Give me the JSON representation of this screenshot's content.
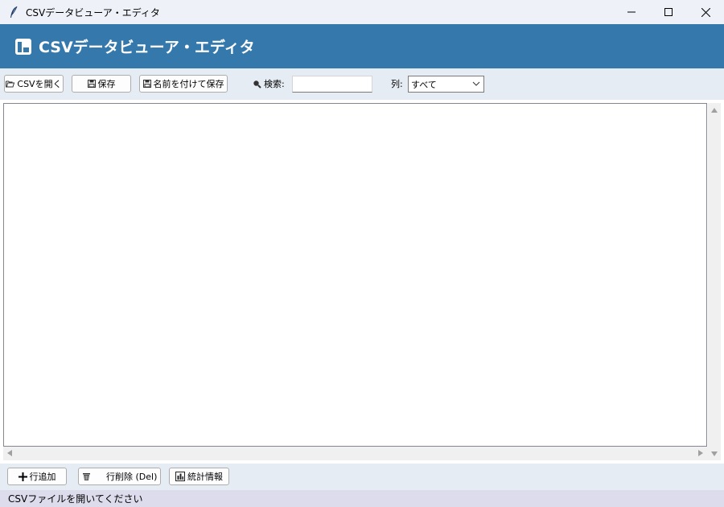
{
  "window": {
    "title": "CSVデータビューア・エディタ",
    "minimize_glyph": "—",
    "maximize_glyph": "☐",
    "close_glyph": "✕"
  },
  "banner": {
    "title": "CSVデータビューア・エディタ",
    "icon": "notebook-icon",
    "background": "#3578ab"
  },
  "toolbar": {
    "open_label": "CSVを開く",
    "save_label": "保存",
    "save_as_label": "名前を付けて保存",
    "search_label": "検索:",
    "search_value": "",
    "column_label": "列:",
    "column_selected": "すべて"
  },
  "bottombar": {
    "add_row_label": "行追加",
    "delete_row_label": "行削除 (Del)",
    "stats_label": "統計情報"
  },
  "status": {
    "text": "CSVファイルを開いてください"
  },
  "colors": {
    "titlebar": "#eef2f8",
    "toolbar": "#e6ecf4",
    "statusbar": "#dcdced"
  }
}
